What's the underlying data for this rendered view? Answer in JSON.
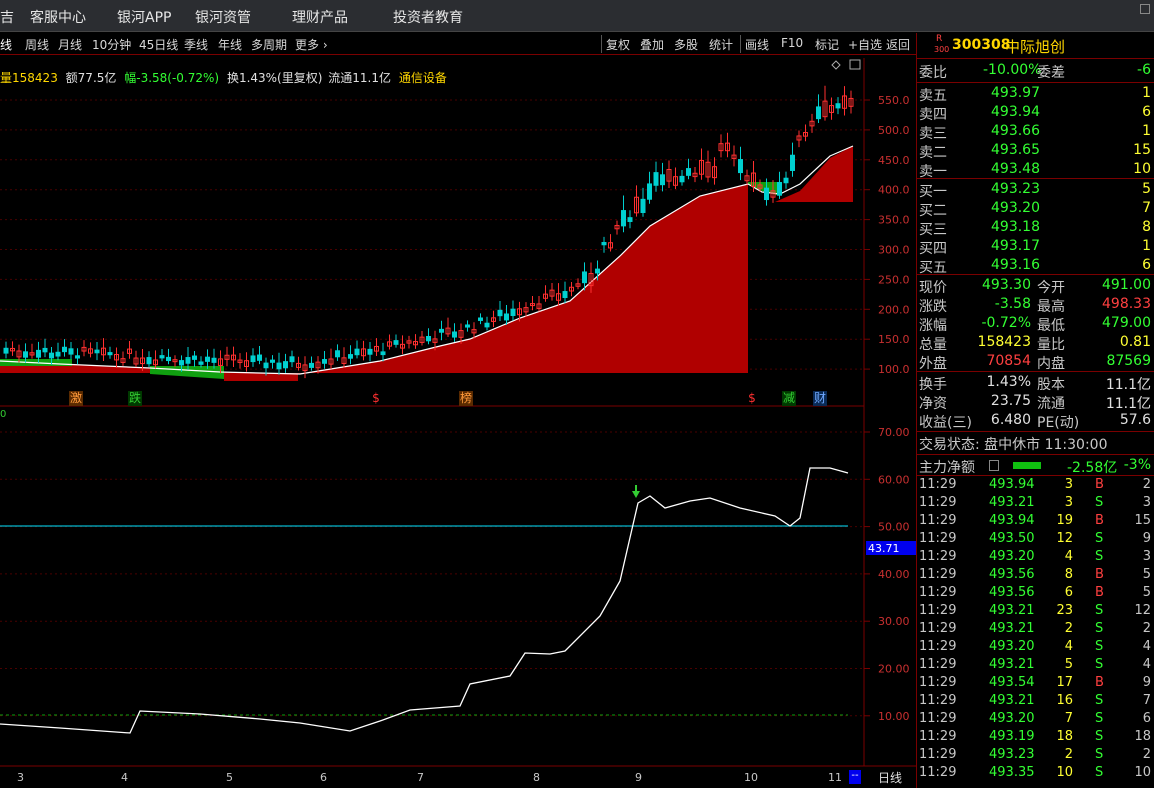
{
  "menu": {
    "partial": "吉",
    "items": [
      "客服中心",
      "银河APP",
      "银河资管",
      "理财产品",
      "投资者教育"
    ]
  },
  "toolbar": {
    "left": [
      "线",
      "周线",
      "月线",
      "10分钟",
      "45日线",
      "季线",
      "年线",
      "多周期",
      "更多 ›"
    ],
    "right": [
      "复权",
      "叠加",
      "多股",
      "统计",
      "画线",
      "F10",
      "标记",
      "+自选",
      "返回"
    ]
  },
  "info": {
    "vol_label": "量",
    "vol": "158423",
    "amt_label": "额",
    "amt": "77.5亿",
    "chg": "幅-3.58(-0.72%)",
    "turnover": "换1.43%(里复权)",
    "float": "流通11.1亿",
    "industry": "通信设备"
  },
  "price_axis": [
    "550.0",
    "500.0",
    "450.0",
    "400.0",
    "350.0",
    "300.0",
    "250.0",
    "200.0",
    "150.0",
    "100.0"
  ],
  "ind_axis": [
    "70.00",
    "60.00",
    "50.00",
    "40.00",
    "30.00",
    "20.00",
    "10.00"
  ],
  "ind_current": "43.71",
  "ind_zero": "0",
  "date_ticks": [
    "3",
    "4",
    "5",
    "6",
    "7",
    "8",
    "9",
    "10",
    "11"
  ],
  "period_label": "日线",
  "dash_btn": "--",
  "tags": [
    {
      "t": "激",
      "c": "#ff9a3a"
    },
    {
      "t": "跌",
      "c": "#33cc33"
    },
    {
      "t": "$",
      "c": "#ff3030"
    },
    {
      "t": "榜",
      "c": "#ff9a3a"
    },
    {
      "t": "$",
      "c": "#ff3030"
    },
    {
      "t": "减",
      "c": "#33cc33"
    },
    {
      "t": "财",
      "c": "#6fa8ff"
    }
  ],
  "stock": {
    "market": "R",
    "market_sub": "300",
    "code": "300308",
    "name": "中际旭创"
  },
  "weibi": {
    "label": "委比",
    "pct": "-10.00%",
    "label2": "委差",
    "diff": "-6"
  },
  "asks": [
    {
      "label": "卖五",
      "price": "493.97",
      "vol": "1"
    },
    {
      "label": "卖四",
      "price": "493.94",
      "vol": "6"
    },
    {
      "label": "卖三",
      "price": "493.66",
      "vol": "1"
    },
    {
      "label": "卖二",
      "price": "493.65",
      "vol": "15"
    },
    {
      "label": "卖一",
      "price": "493.48",
      "vol": "10"
    }
  ],
  "bids": [
    {
      "label": "买一",
      "price": "493.23",
      "vol": "5"
    },
    {
      "label": "买二",
      "price": "493.20",
      "vol": "7"
    },
    {
      "label": "买三",
      "price": "493.18",
      "vol": "8"
    },
    {
      "label": "买四",
      "price": "493.17",
      "vol": "1"
    },
    {
      "label": "买五",
      "price": "493.16",
      "vol": "6"
    }
  ],
  "quote": [
    {
      "l1": "现价",
      "v1": "493.30",
      "c1": "#33ff33",
      "l2": "今开",
      "v2": "491.00",
      "c2": "#33ff33"
    },
    {
      "l1": "涨跌",
      "v1": "-3.58",
      "c1": "#33ff33",
      "l2": "最高",
      "v2": "498.33",
      "c2": "#ff4040"
    },
    {
      "l1": "涨幅",
      "v1": "-0.72%",
      "c1": "#33ff33",
      "l2": "最低",
      "v2": "479.00",
      "c2": "#33ff33"
    },
    {
      "l1": "总量",
      "v1": "158423",
      "c1": "#ffff33",
      "l2": "量比",
      "v2": "0.81",
      "c2": "#ffff33"
    },
    {
      "l1": "外盘",
      "v1": "70854",
      "c1": "#ff4040",
      "l2": "内盘",
      "v2": "87569",
      "c2": "#33ff33"
    }
  ],
  "stats": [
    {
      "l1": "换手",
      "v1": "1.43%",
      "l2": "股本",
      "v2": "11.1亿"
    },
    {
      "l1": "净资",
      "v1": "23.75",
      "l2": "流通",
      "v2": "11.1亿"
    },
    {
      "l1": "收益(三)",
      "v1": "6.480",
      "l2": "PE(动)",
      "v2": "57.6"
    }
  ],
  "status": "交易状态: 盘中休市 11:30:00",
  "mainforce": {
    "label": "主力净额",
    "value": "-2.58亿",
    "pct": "-3%"
  },
  "ticks": [
    {
      "t": "11:29",
      "p": "493.94",
      "v": "3",
      "bs": "B",
      "n": "2"
    },
    {
      "t": "11:29",
      "p": "493.21",
      "v": "3",
      "bs": "S",
      "n": "3"
    },
    {
      "t": "11:29",
      "p": "493.94",
      "v": "19",
      "bs": "B",
      "n": "15"
    },
    {
      "t": "11:29",
      "p": "493.50",
      "v": "12",
      "bs": "S",
      "n": "9"
    },
    {
      "t": "11:29",
      "p": "493.20",
      "v": "4",
      "bs": "S",
      "n": "3"
    },
    {
      "t": "11:29",
      "p": "493.56",
      "v": "8",
      "bs": "B",
      "n": "5"
    },
    {
      "t": "11:29",
      "p": "493.56",
      "v": "6",
      "bs": "B",
      "n": "5"
    },
    {
      "t": "11:29",
      "p": "493.21",
      "v": "23",
      "bs": "S",
      "n": "12"
    },
    {
      "t": "11:29",
      "p": "493.21",
      "v": "2",
      "bs": "S",
      "n": "2"
    },
    {
      "t": "11:29",
      "p": "493.20",
      "v": "4",
      "bs": "S",
      "n": "4"
    },
    {
      "t": "11:29",
      "p": "493.21",
      "v": "5",
      "bs": "S",
      "n": "4"
    },
    {
      "t": "11:29",
      "p": "493.54",
      "v": "17",
      "bs": "B",
      "n": "9"
    },
    {
      "t": "11:29",
      "p": "493.21",
      "v": "16",
      "bs": "S",
      "n": "7"
    },
    {
      "t": "11:29",
      "p": "493.20",
      "v": "7",
      "bs": "S",
      "n": "6"
    },
    {
      "t": "11:29",
      "p": "493.19",
      "v": "18",
      "bs": "S",
      "n": "18"
    },
    {
      "t": "11:29",
      "p": "493.23",
      "v": "2",
      "bs": "S",
      "n": "2"
    },
    {
      "t": "11:29",
      "p": "493.35",
      "v": "10",
      "bs": "S",
      "n": "10"
    }
  ],
  "colors": {
    "up": "#ff3030",
    "down": "#33cc33",
    "axis": "#7a0000",
    "grid": "#5a0000",
    "cyan": "#00e5ff"
  }
}
